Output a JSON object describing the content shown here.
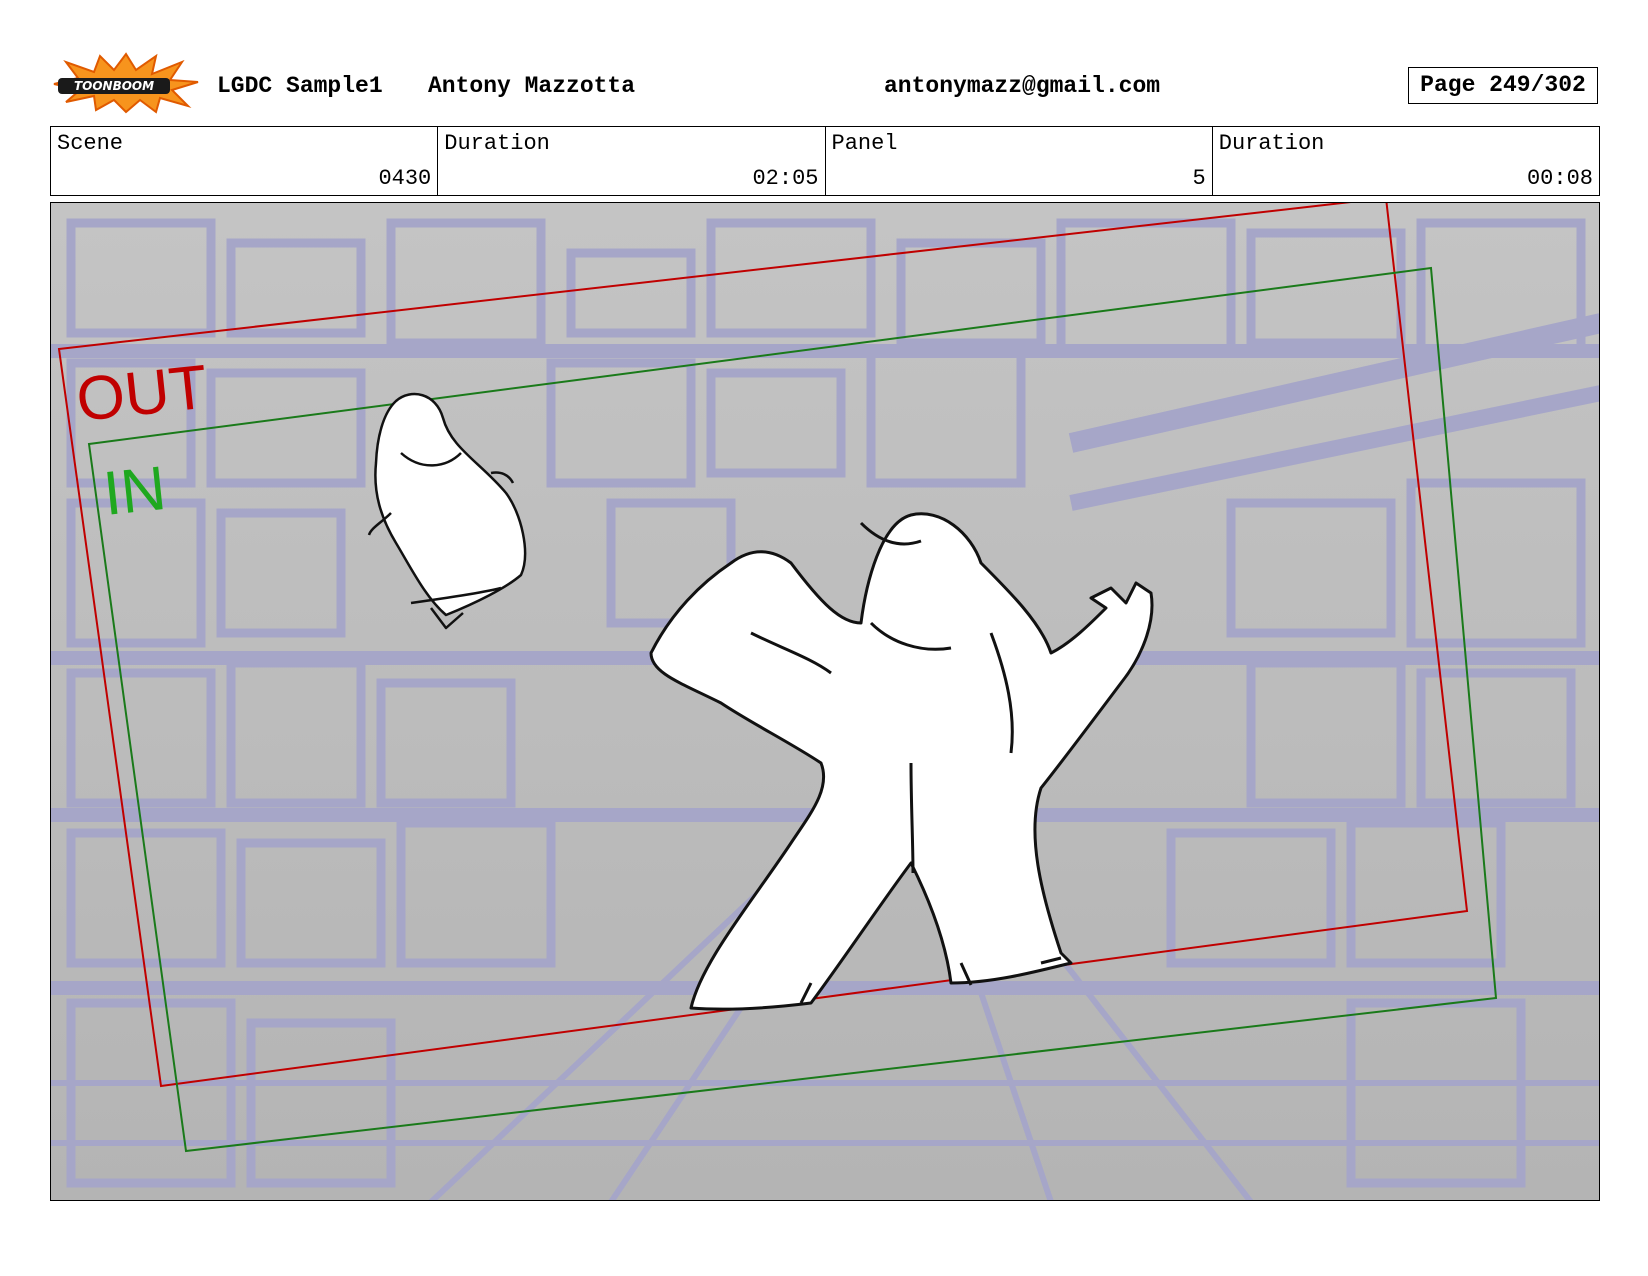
{
  "header": {
    "logo_text": "TOONBOOM",
    "project": "LGDC Sample1",
    "author": "Antony Mazzotta",
    "email": "antonymazz@gmail.com",
    "page": "Page 249/302"
  },
  "info": {
    "scene_label": "Scene",
    "scene_value": "0430",
    "scene_duration_label": "Duration",
    "scene_duration_value": "02:05",
    "panel_label": "Panel",
    "panel_value": "5",
    "panel_duration_label": "Duration",
    "panel_duration_value": "00:08"
  },
  "panel": {
    "out_label": "OUT",
    "in_label": "IN",
    "colors": {
      "background": "#bdbdbd",
      "structure": "#a6a6c8",
      "out_frame": "#c00000",
      "in_frame": "#1a7a1a",
      "in_text": "#1fa81f"
    }
  }
}
